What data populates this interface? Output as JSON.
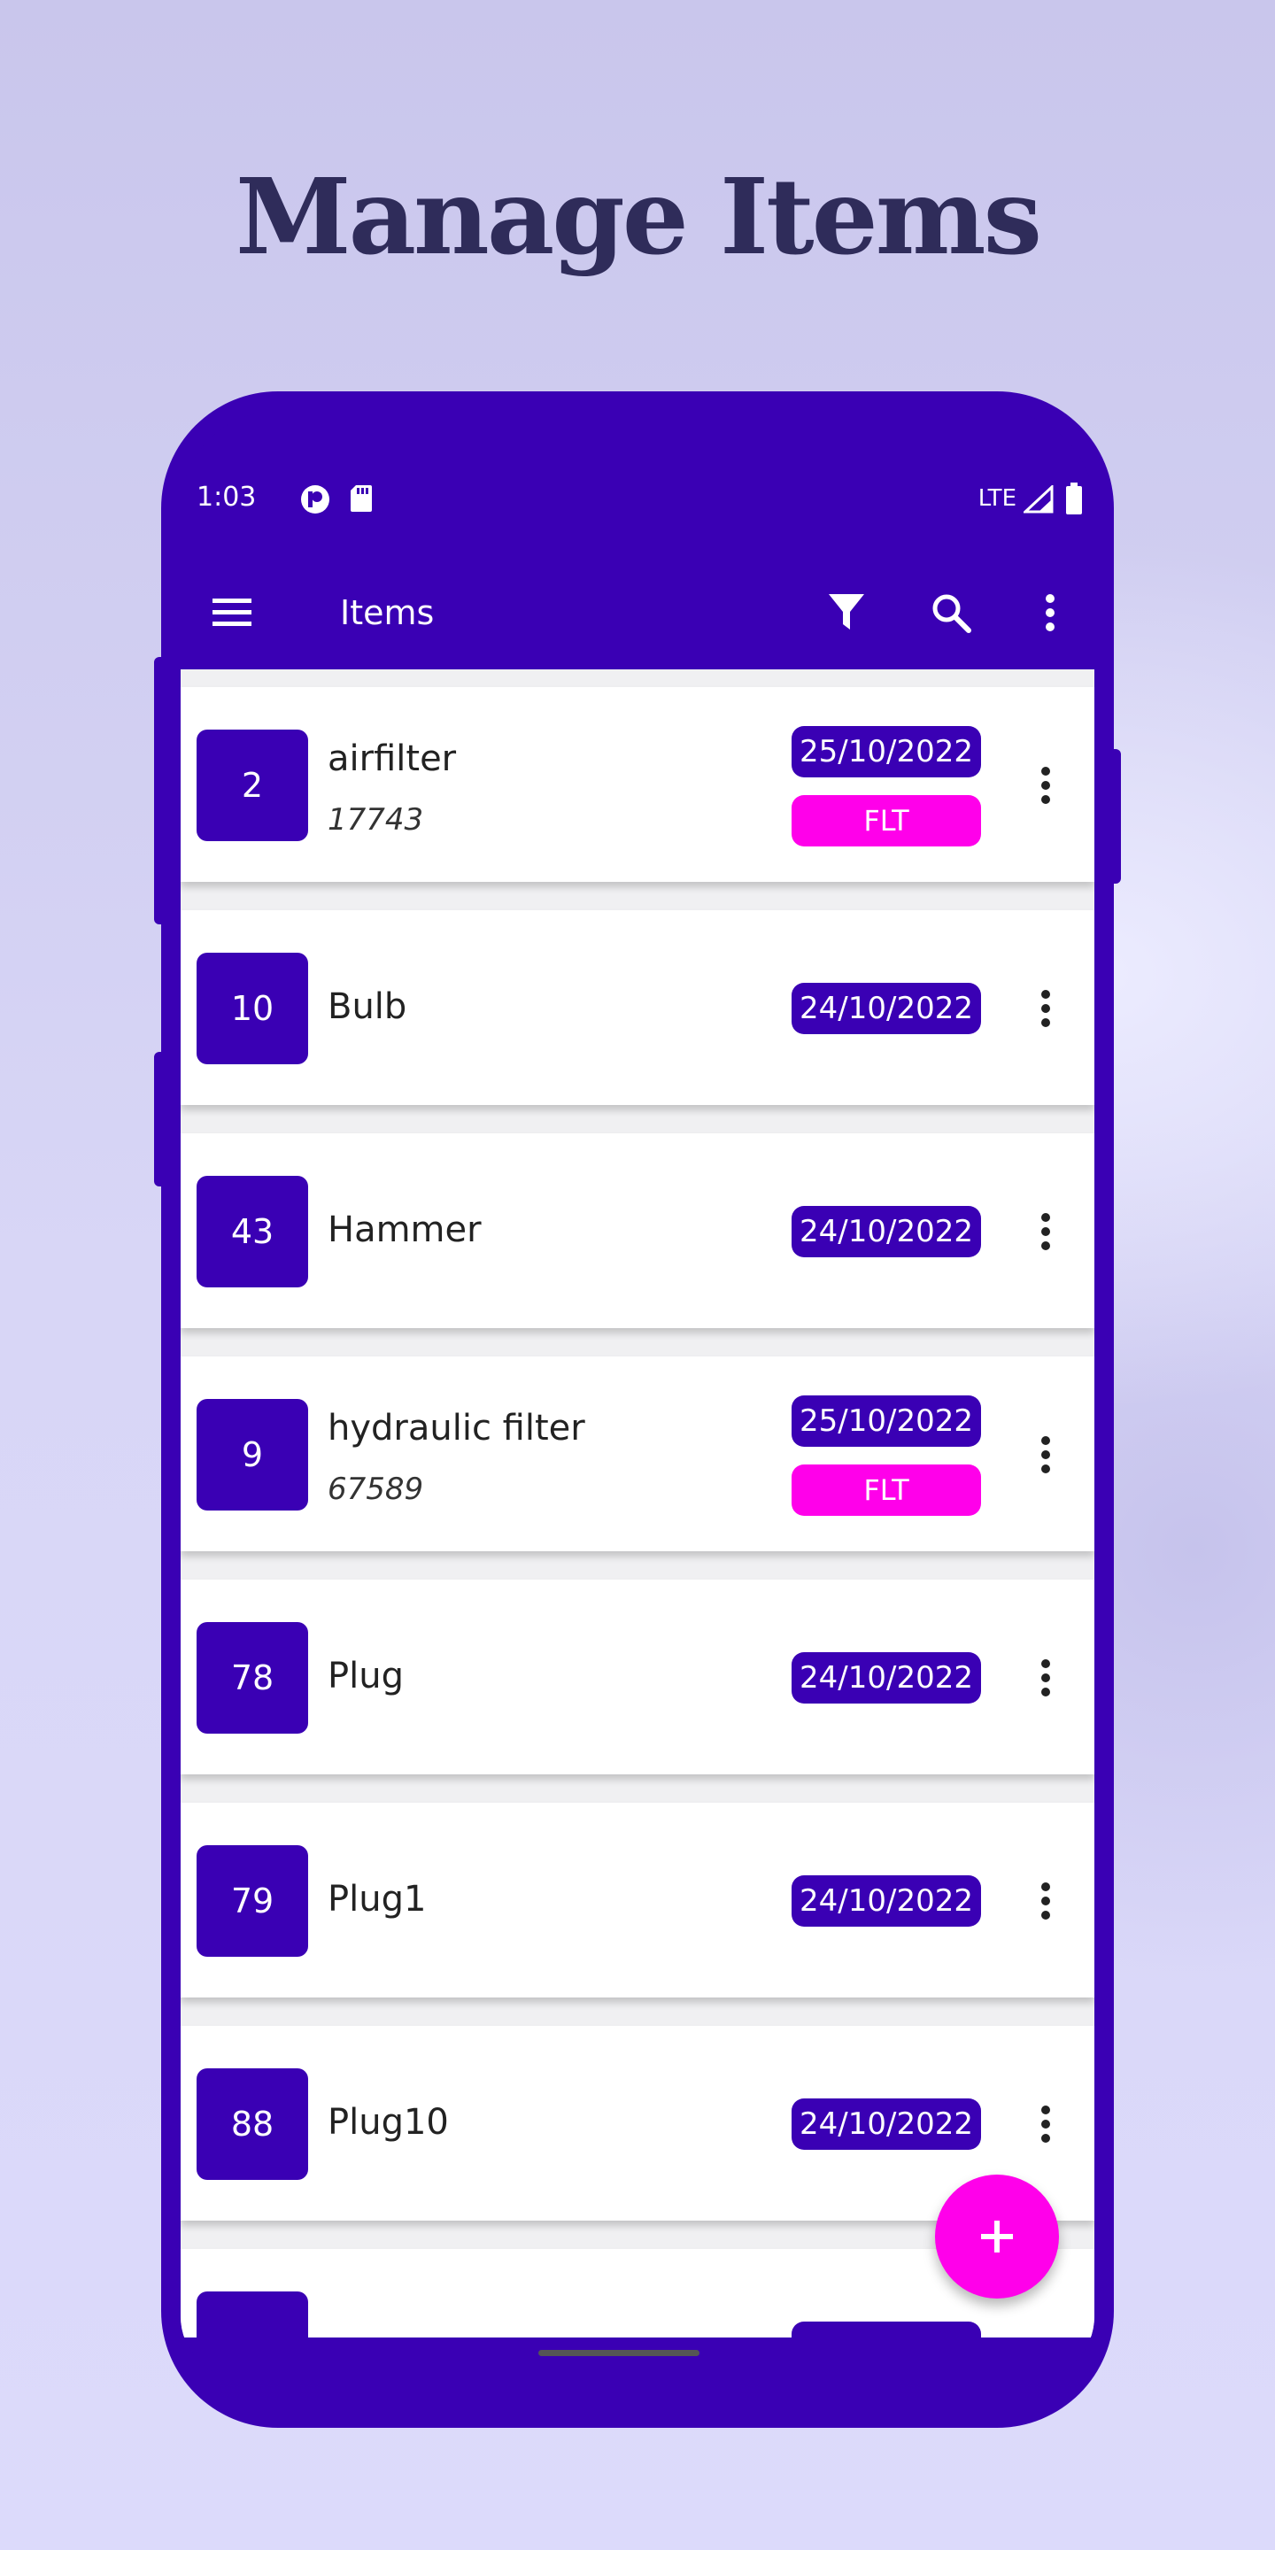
{
  "page": {
    "title": "Manage Items"
  },
  "status_bar": {
    "time": "1:03",
    "network": "LTE"
  },
  "app_bar": {
    "title": "Items"
  },
  "items": [
    {
      "qty": "2",
      "name": "airfilter",
      "code": "17743",
      "date": "25/10/2022",
      "tag": "FLT"
    },
    {
      "qty": "10",
      "name": "Bulb",
      "code": "",
      "date": "24/10/2022",
      "tag": ""
    },
    {
      "qty": "43",
      "name": "Hammer",
      "code": "",
      "date": "24/10/2022",
      "tag": ""
    },
    {
      "qty": "9",
      "name": "hydraulic filter",
      "code": "67589",
      "date": "25/10/2022",
      "tag": "FLT"
    },
    {
      "qty": "78",
      "name": "Plug",
      "code": "",
      "date": "24/10/2022",
      "tag": ""
    },
    {
      "qty": "79",
      "name": "Plug1",
      "code": "",
      "date": "24/10/2022",
      "tag": ""
    },
    {
      "qty": "88",
      "name": "Plug10",
      "code": "",
      "date": "24/10/2022",
      "tag": ""
    }
  ],
  "colors": {
    "primary": "#3a00b4",
    "accent": "#ff00ea",
    "title": "#2f2c5a"
  },
  "icons": {
    "menu": "menu-icon",
    "filter": "filter-icon",
    "search": "search-icon",
    "overflow": "more-vert-icon",
    "add": "plus-icon"
  }
}
